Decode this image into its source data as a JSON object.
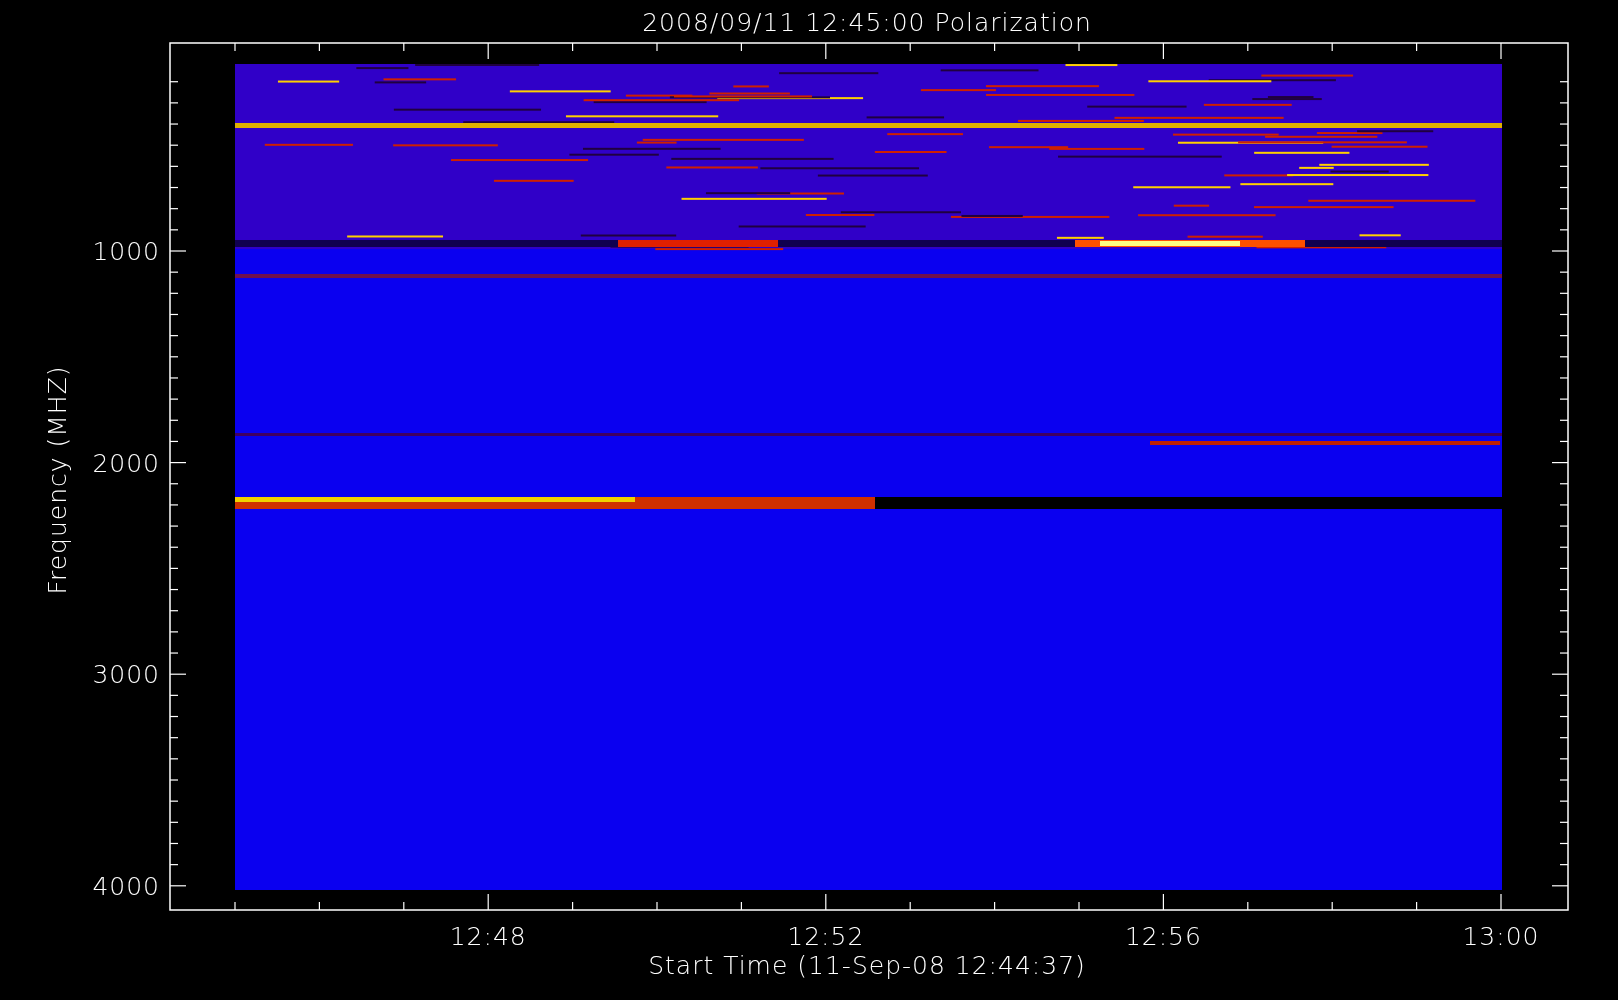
{
  "title": "2008/09/11 12:45:00 Polarization",
  "x_axis": {
    "label": "Start Time (11-Sep-08 12:44:37)",
    "ticks": [
      "12:48",
      "12:52",
      "12:56",
      "13:00"
    ]
  },
  "y_axis": {
    "label": "Frequency (MHZ)",
    "ticks": [
      "1000",
      "2000",
      "3000",
      "4000"
    ]
  }
}
